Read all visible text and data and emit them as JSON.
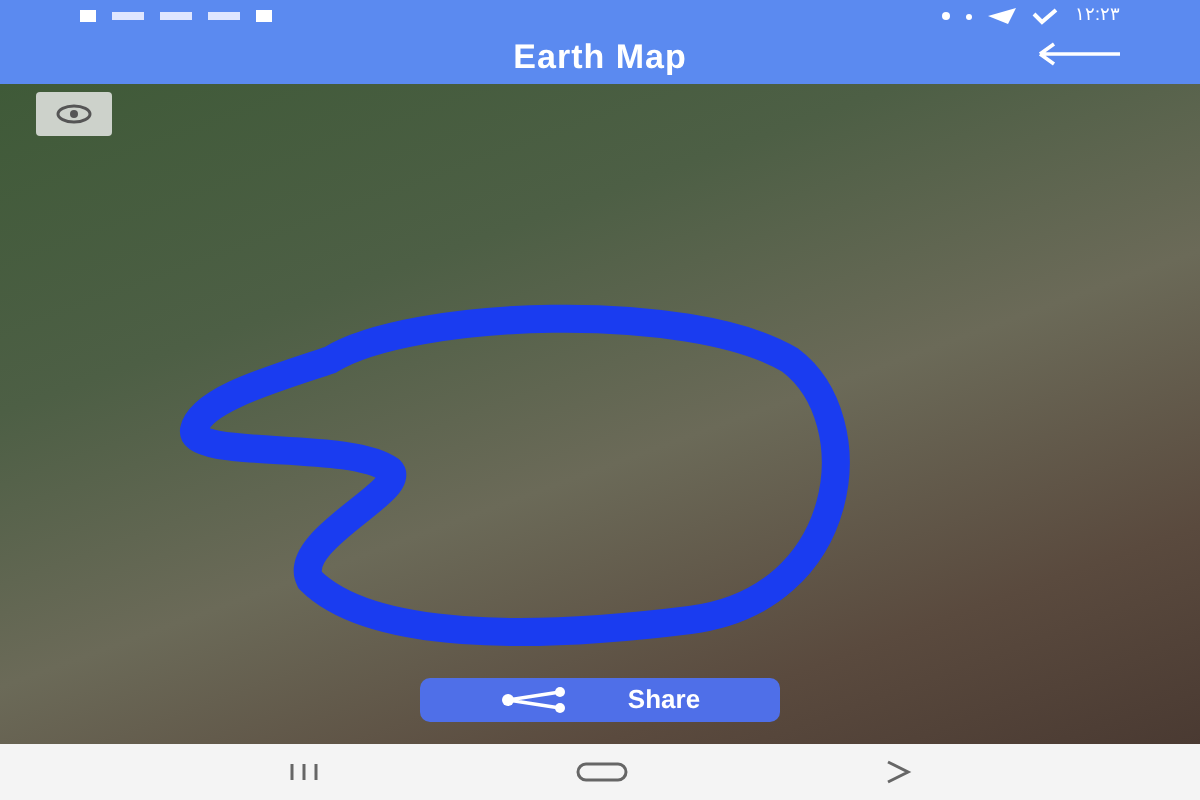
{
  "status_bar": {
    "time": "۱۲:۲۳"
  },
  "app_bar": {
    "title": "Earth Map"
  },
  "map": {
    "share_button": {
      "label": "Share"
    }
  }
}
